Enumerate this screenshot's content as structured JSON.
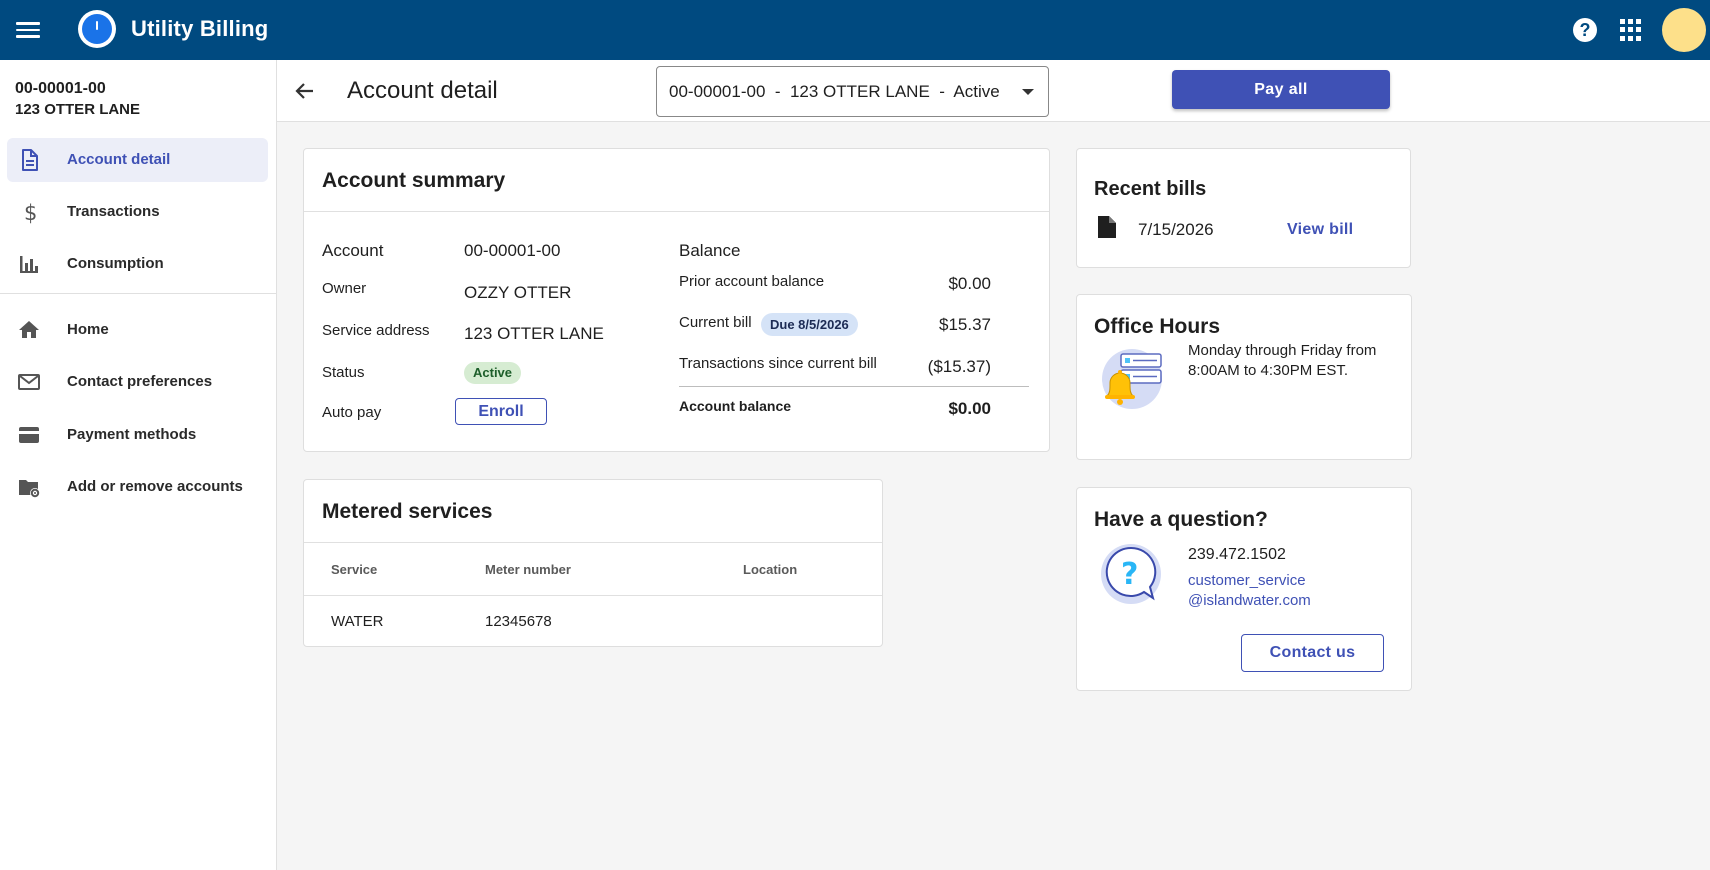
{
  "app": {
    "title": "Utility Billing"
  },
  "topbar": {
    "menu_icon": "menu-icon",
    "help_icon": "help-icon",
    "apps_icon": "apps-grid-icon",
    "avatar_color": "#fde08a"
  },
  "sidebar": {
    "account_number": "00-00001-00",
    "account_address": "123 OTTER LANE",
    "items": [
      {
        "label": "Account detail",
        "icon": "document-icon",
        "active": true
      },
      {
        "label": "Transactions",
        "icon": "dollar-icon",
        "active": false
      },
      {
        "label": "Consumption",
        "icon": "bar-chart-icon",
        "active": false
      },
      {
        "label": "Home",
        "icon": "home-icon",
        "active": false
      },
      {
        "label": "Contact preferences",
        "icon": "mail-icon",
        "active": false
      },
      {
        "label": "Payment methods",
        "icon": "credit-card-icon",
        "active": false
      },
      {
        "label": "Add or remove accounts",
        "icon": "folder-settings-icon",
        "active": false
      }
    ]
  },
  "header": {
    "page_title": "Account detail",
    "account_select": "00-00001-00  -  123 OTTER LANE  -  Active",
    "pay_all_label": "Pay all"
  },
  "summary": {
    "title": "Account summary",
    "account_label": "Account",
    "account_value": "00-00001-00",
    "owner_label": "Owner",
    "owner_value": "OZZY OTTER",
    "address_label": "Service address",
    "address_value": "123 OTTER LANE",
    "status_label": "Status",
    "status_value": "Active",
    "autopay_label": "Auto pay",
    "enroll_label": "Enroll",
    "balance_heading": "Balance",
    "prior_label": "Prior account balance",
    "prior_value": "$0.00",
    "current_label": "Current bill",
    "due_badge": "Due 8/5/2026",
    "current_value": "$15.37",
    "transactions_label": "Transactions since current bill",
    "transactions_value": "($15.37)",
    "account_balance_label": "Account balance",
    "account_balance_value": "$0.00"
  },
  "metered": {
    "title": "Metered services",
    "columns": [
      "Service",
      "Meter number",
      "Location"
    ],
    "rows": [
      {
        "service": "WATER",
        "meter": "12345678",
        "location": ""
      }
    ]
  },
  "recent_bills": {
    "title": "Recent bills",
    "items": [
      {
        "date": "7/15/2026",
        "action": "View bill"
      }
    ]
  },
  "office_hours": {
    "title": "Office Hours",
    "text": "Monday through Friday from 8:00AM to 4:30PM EST."
  },
  "question": {
    "title": "Have a question?",
    "phone": "239.472.1502",
    "email_line1": "customer_service",
    "email_line2": "@islandwater.com",
    "contact_label": "Contact us"
  },
  "colors": {
    "topbar": "#004a80",
    "accent": "#3f51b5",
    "active_bg": "#eceef8"
  }
}
